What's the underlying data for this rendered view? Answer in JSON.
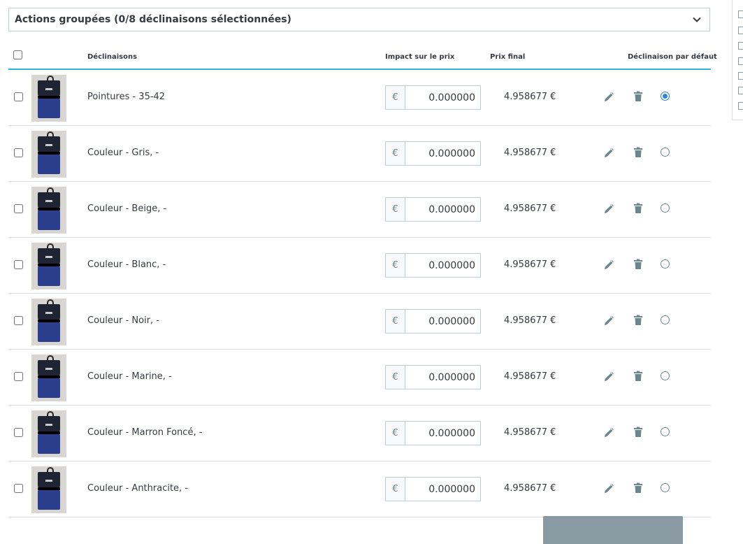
{
  "bulk_actions": {
    "label": "Actions groupées (0/8 déclinaisons sélectionnées)",
    "icon": "chevron-down-icon"
  },
  "table": {
    "headers": {
      "combinations": "Déclinaisons",
      "price_impact": "Impact sur le prix",
      "final_price": "Prix final",
      "default": "Déclinaison par défaut"
    },
    "currency_symbol": "€",
    "rows": [
      {
        "name": "Pointures - 35-42",
        "impact": "0.000000",
        "final_price": "4.958677 €",
        "default": true
      },
      {
        "name": "Couleur - Gris, -",
        "impact": "0.000000",
        "final_price": "4.958677 €",
        "default": false
      },
      {
        "name": "Couleur - Beige, -",
        "impact": "0.000000",
        "final_price": "4.958677 €",
        "default": false
      },
      {
        "name": "Couleur - Blanc, -",
        "impact": "0.000000",
        "final_price": "4.958677 €",
        "default": false
      },
      {
        "name": "Couleur - Noir, -",
        "impact": "0.000000",
        "final_price": "4.958677 €",
        "default": false
      },
      {
        "name": "Couleur - Marine, -",
        "impact": "0.000000",
        "final_price": "4.958677 €",
        "default": false
      },
      {
        "name": "Couleur - Marron Foncé, -",
        "impact": "0.000000",
        "final_price": "4.958677 €",
        "default": false
      },
      {
        "name": "Couleur - Anthracite, -",
        "impact": "0.000000",
        "final_price": "4.958677 €",
        "default": false
      }
    ]
  },
  "icons": {
    "edit": "pencil-icon",
    "delete": "trash-icon"
  },
  "colors": {
    "accent": "#25b9d7",
    "radio_selected": "#2a86d4",
    "border": "#bbcdd2"
  }
}
